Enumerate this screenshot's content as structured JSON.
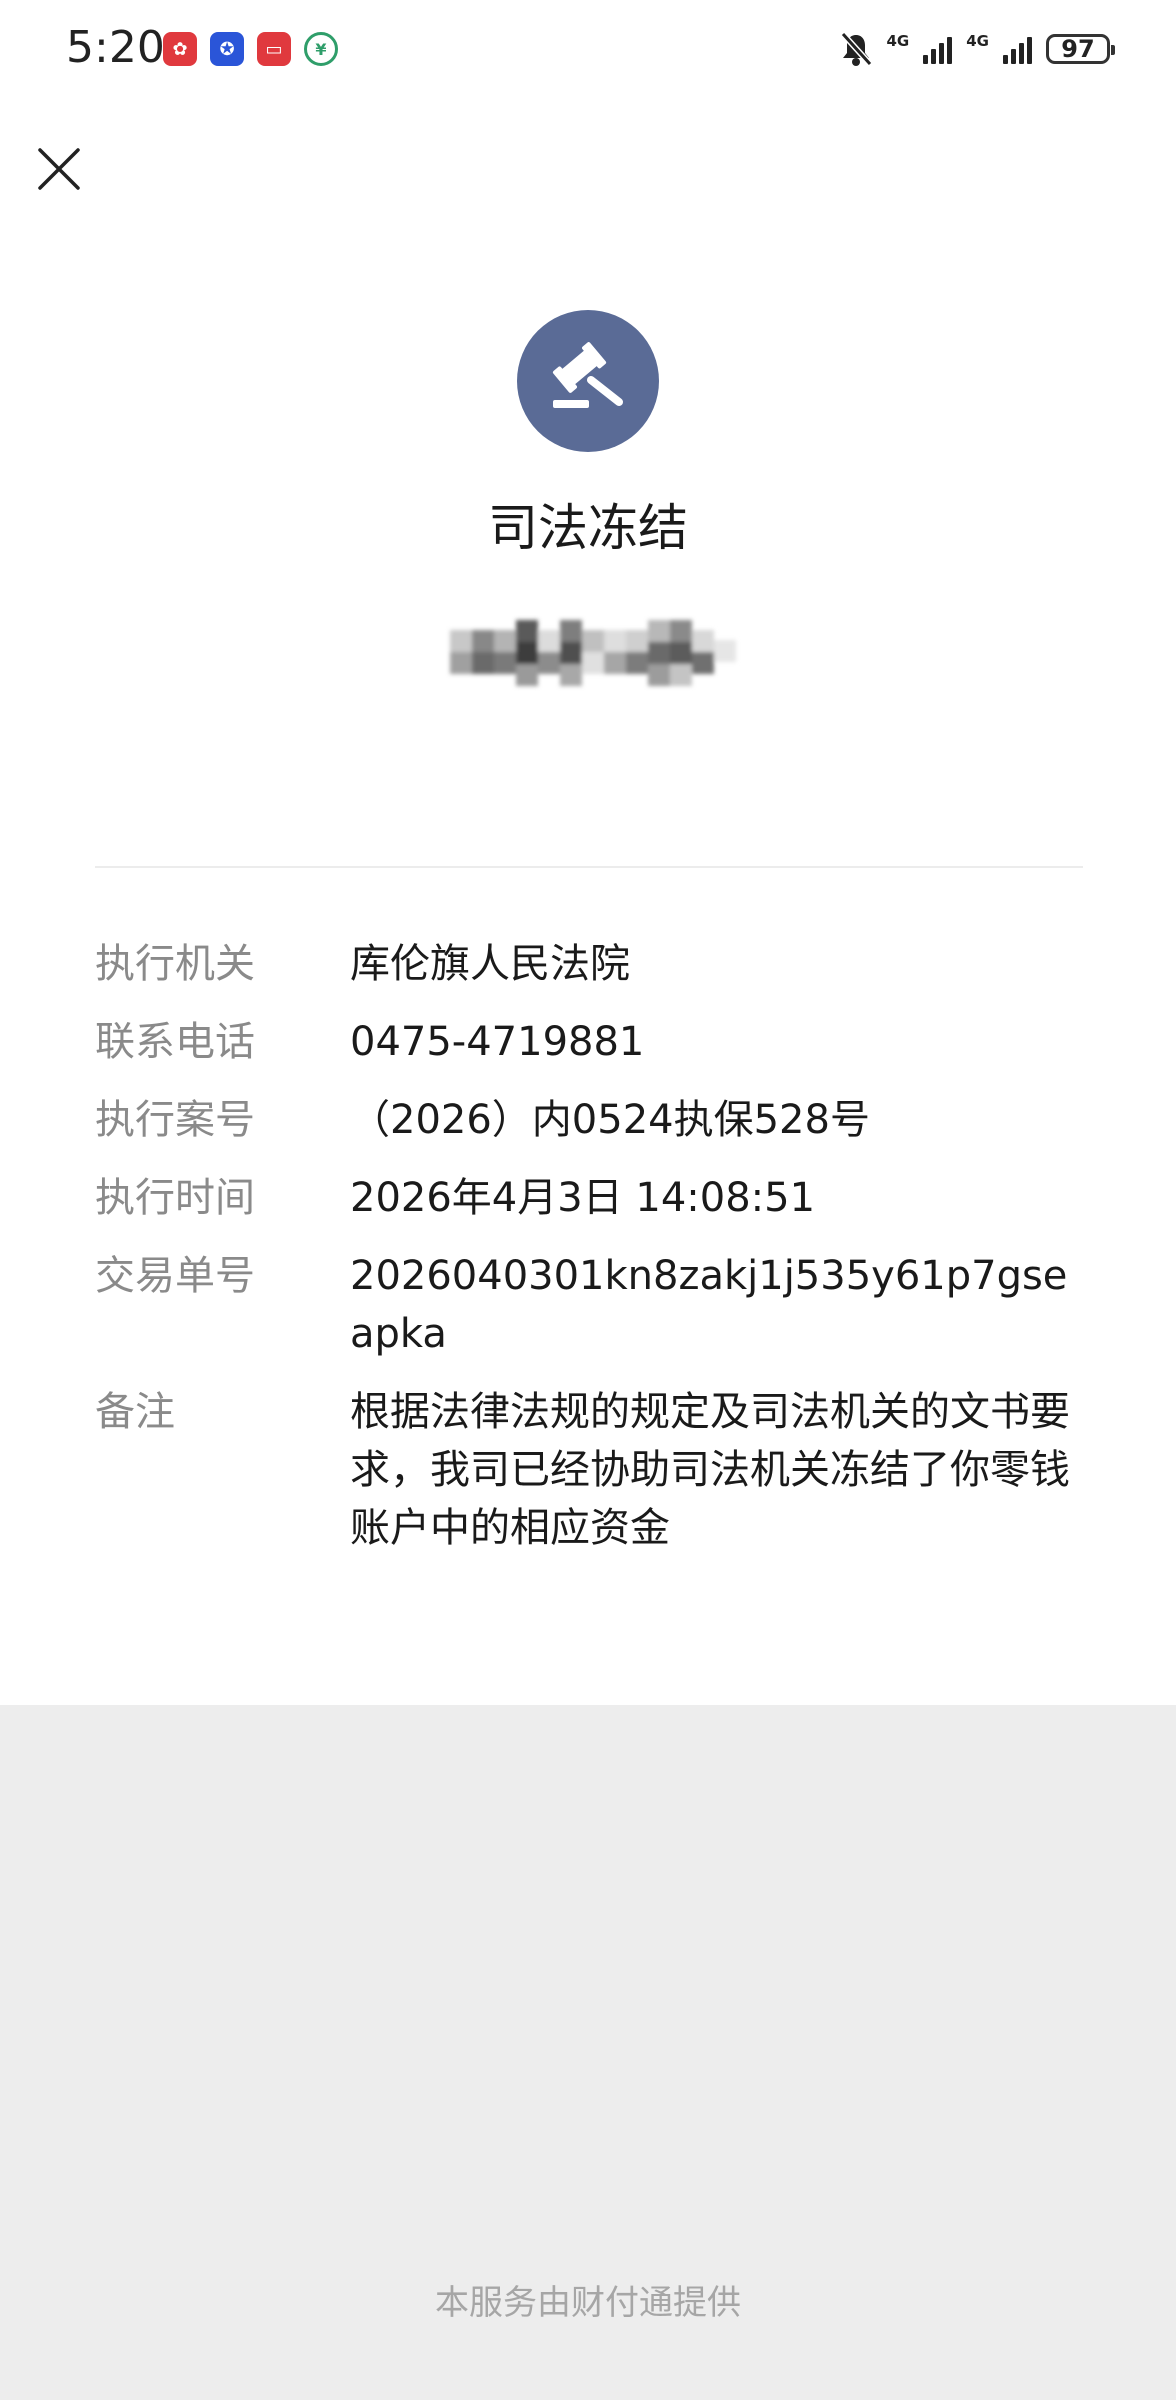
{
  "status_bar": {
    "time": "5:20",
    "network_1": "4G",
    "network_2": "4G",
    "battery": "97"
  },
  "header": {
    "title": "司法冻结"
  },
  "details": [
    {
      "label": "执行机关",
      "value": "库伦旗人民法院"
    },
    {
      "label": "联系电话",
      "value": "0475-4719881"
    },
    {
      "label": "执行案号",
      "value": "（2026）内0524执保528号"
    },
    {
      "label": "执行时间",
      "value": "2026年4月3日 14:08:51"
    },
    {
      "label": "交易单号",
      "value": "2026040301kn8zakj1j535y61p7gseapka"
    },
    {
      "label": "备注",
      "value": "根据法律法规的规定及司法机关的文书要求，我司已经协助司法机关冻结了你零钱账户中的相应资金"
    }
  ],
  "footer": {
    "text": "本服务由财付通提供"
  },
  "colors": {
    "icon_bg": "#5a6b96",
    "label": "#8a8a8a",
    "footer": "#a6a6a6",
    "page_bg": "#ededed"
  }
}
